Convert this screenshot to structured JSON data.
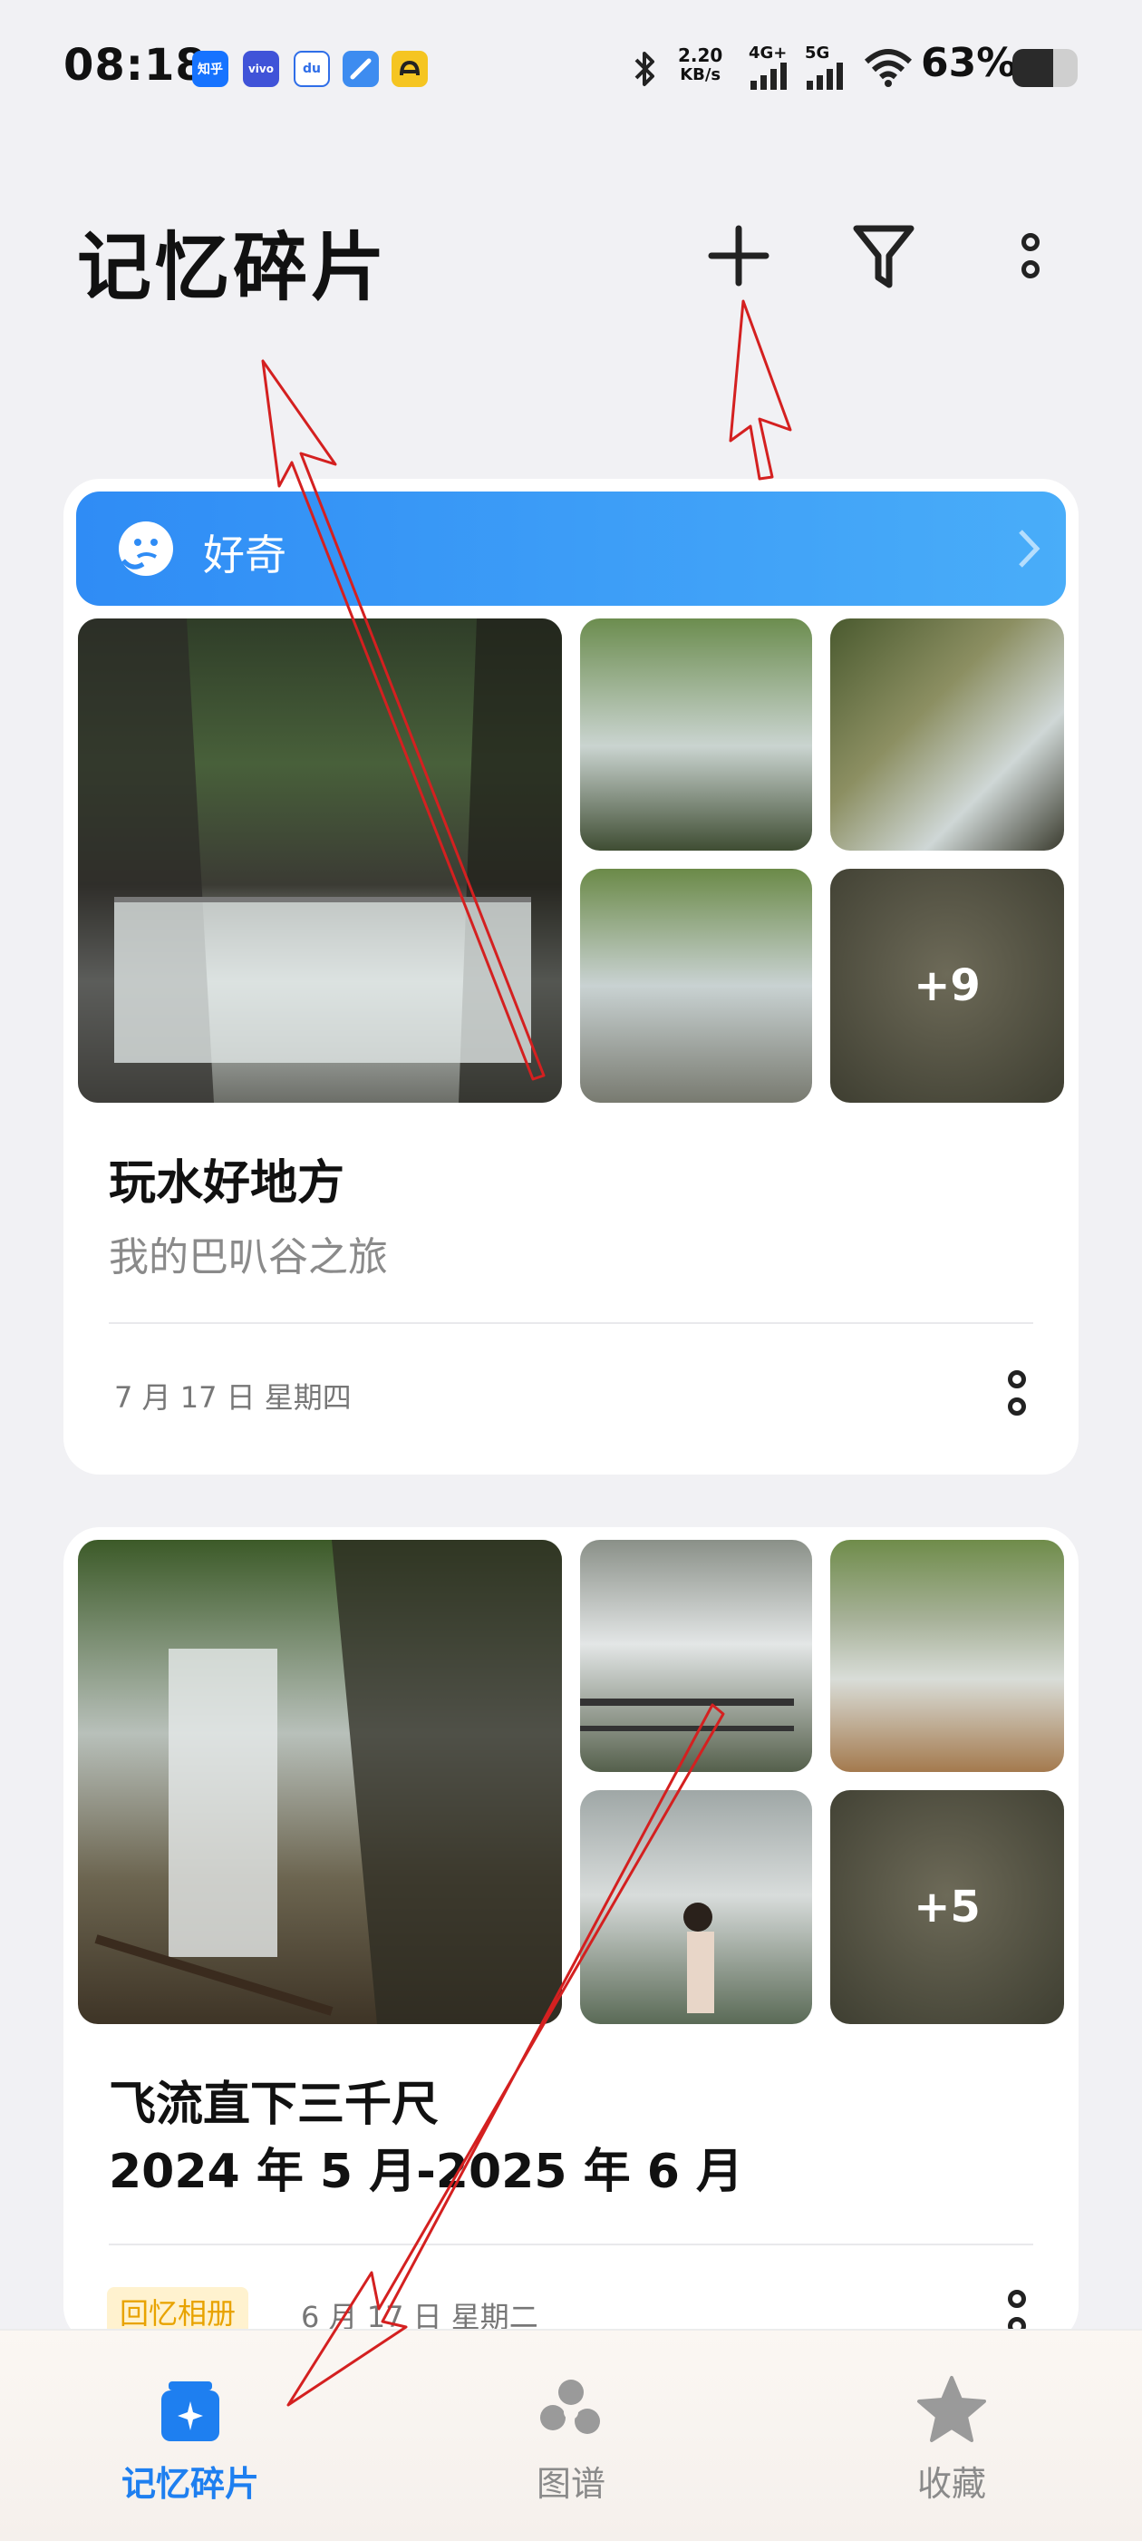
{
  "status_bar": {
    "time": "08:18",
    "app_icons": [
      {
        "name": "zhihu-icon",
        "text": "知乎",
        "color": "#1673ff"
      },
      {
        "name": "vivo-icon",
        "text": "vivo",
        "color": "#4053d8"
      },
      {
        "name": "baidu-icon",
        "text": "du",
        "color": "#ffffff"
      },
      {
        "name": "browser-icon",
        "text": "",
        "color": "#3d8cf0"
      },
      {
        "name": "app-yellow-icon",
        "text": "",
        "color": "#f5c521"
      }
    ],
    "net_speed": "2.20",
    "net_speed_unit": "KB/s",
    "net_4g": "4G+",
    "net_5g": "5G",
    "battery_percent": "63%",
    "battery_level": 0.63
  },
  "header": {
    "title": "记忆碎片",
    "add_icon": "plus-icon",
    "filter_icon": "filter-icon",
    "more_icon": "more-vertical-icon"
  },
  "cards": [
    {
      "banner": {
        "label": "好奇",
        "icon": "thinking-face-icon"
      },
      "more_count": "+9",
      "title": "玩水好地方",
      "subtitle": "我的巴叭谷之旅",
      "date": "7 月 17 日  星期四"
    },
    {
      "more_count": "+5",
      "title_line1": "飞流直下三千尺",
      "title_line2": "2024 年 5 月-2025 年 6 月",
      "tag": "回忆相册",
      "date": "6 月 17 日  星期二"
    }
  ],
  "bottom_nav": {
    "items": [
      {
        "label": "记忆碎片",
        "icon": "memory-fragments-icon",
        "active": true
      },
      {
        "label": "图谱",
        "icon": "graph-icon",
        "active": false
      },
      {
        "label": "收藏",
        "icon": "star-icon",
        "active": false
      }
    ]
  },
  "colors": {
    "accent": "#1e7ff0",
    "banner": "#3d9cf7",
    "annotation": "#d42020"
  }
}
